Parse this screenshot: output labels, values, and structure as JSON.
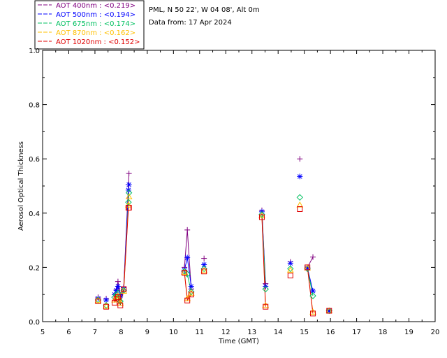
{
  "chart_data": {
    "type": "scatter",
    "title_lines": [
      "PML, N 50 22', W 04 08', Alt 0m",
      "Data from: 17 Apr 2024"
    ],
    "xlabel": "Time (GMT)",
    "ylabel": "Aerosol Optical Thickness",
    "xlim": [
      5,
      20
    ],
    "ylim": [
      0,
      1.0
    ],
    "xticks": [
      5,
      6,
      7,
      8,
      9,
      10,
      11,
      12,
      13,
      14,
      15,
      16,
      17,
      18,
      19,
      20
    ],
    "xtick_labels": [
      "5",
      "6",
      "7",
      "8",
      "9",
      "10",
      "11",
      "12",
      "13",
      "14",
      "15",
      "16",
      "17",
      "18",
      "19",
      "20"
    ],
    "yticks": [
      0,
      0.2,
      0.4,
      0.6,
      0.8,
      1.0
    ],
    "ytick_labels": [
      "0.0",
      "0.2",
      "0.4",
      "0.6",
      "0.8",
      "1.0"
    ],
    "grid": false,
    "legend_placement": "top-left",
    "series": [
      {
        "name": "AOT 400nm",
        "legend_label": "AOT  400nm : <0.219>",
        "color": "#800080",
        "marker": "plus",
        "x": [
          7.12,
          7.43,
          7.75,
          7.82,
          7.88,
          7.97,
          8.1,
          8.28,
          8.3,
          10.42,
          10.53,
          10.68,
          11.17,
          13.38,
          13.52,
          14.47,
          14.83,
          15.12,
          15.33,
          15.95
        ],
        "y": [
          0.09,
          0.085,
          0.1,
          0.12,
          0.148,
          0.1,
          0.125,
          0.505,
          0.546,
          0.2,
          0.338,
          0.12,
          0.233,
          0.41,
          0.14,
          0.22,
          0.6,
          0.2,
          0.238,
          0.04
        ],
        "segments": [
          [
            2,
            8
          ],
          [
            9,
            11
          ],
          [
            13,
            14
          ],
          [
            17,
            18
          ]
        ]
      },
      {
        "name": "AOT 500nm",
        "legend_label": "AOT  500nm : <0.194>",
        "color": "#0000ff",
        "marker": "asterisk",
        "x": [
          7.12,
          7.43,
          7.75,
          7.82,
          7.88,
          7.97,
          8.1,
          8.28,
          8.3,
          10.42,
          10.53,
          10.68,
          11.17,
          13.38,
          13.52,
          14.47,
          14.83,
          15.12,
          15.33,
          15.95
        ],
        "y": [
          0.085,
          0.08,
          0.1,
          0.115,
          0.13,
          0.095,
          0.12,
          0.485,
          0.505,
          0.19,
          0.236,
          0.13,
          0.21,
          0.405,
          0.13,
          0.215,
          0.535,
          0.198,
          0.113,
          0.04
        ],
        "segments": [
          [
            2,
            8
          ],
          [
            9,
            11
          ],
          [
            13,
            14
          ],
          [
            17,
            18
          ]
        ]
      },
      {
        "name": "AOT 675nm",
        "legend_label": "AOT  675nm : <0.174>",
        "color": "#00c060",
        "marker": "diamond",
        "x": [
          7.12,
          7.43,
          7.75,
          7.82,
          7.88,
          7.97,
          8.1,
          8.28,
          8.3,
          10.42,
          10.53,
          10.68,
          11.17,
          13.38,
          13.52,
          14.47,
          14.83,
          15.12,
          15.33,
          15.95
        ],
        "y": [
          0.08,
          0.06,
          0.09,
          0.1,
          0.105,
          0.075,
          0.115,
          0.44,
          0.475,
          0.185,
          0.175,
          0.11,
          0.195,
          0.395,
          0.12,
          0.195,
          0.458,
          0.195,
          0.095,
          0.04
        ],
        "segments": [
          [
            2,
            8
          ],
          [
            9,
            11
          ],
          [
            13,
            14
          ],
          [
            17,
            18
          ]
        ]
      },
      {
        "name": "AOT 870nm",
        "legend_label": "AOT  870nm : <0.162>",
        "color": "#ffc000",
        "marker": "triangle",
        "x": [
          7.12,
          7.43,
          7.75,
          7.82,
          7.88,
          7.97,
          8.1,
          8.28,
          8.3,
          10.42,
          10.53,
          10.68,
          11.17,
          13.38,
          13.52,
          14.47,
          14.83,
          15.12,
          15.33,
          15.95
        ],
        "y": [
          0.078,
          0.057,
          0.08,
          0.09,
          0.095,
          0.068,
          0.112,
          0.43,
          0.46,
          0.182,
          0.085,
          0.105,
          0.188,
          0.39,
          0.06,
          0.19,
          0.43,
          0.198,
          0.035,
          0.04
        ],
        "segments": [
          [
            2,
            8
          ],
          [
            9,
            11
          ],
          [
            13,
            14
          ],
          [
            17,
            18
          ]
        ]
      },
      {
        "name": "AOT 1020nm",
        "legend_label": "AOT 1020nm : <0.152>",
        "color": "#e00000",
        "marker": "square",
        "x": [
          7.12,
          7.43,
          7.75,
          7.82,
          7.88,
          7.97,
          8.1,
          8.28,
          8.3,
          10.42,
          10.53,
          10.68,
          11.17,
          13.38,
          13.52,
          14.47,
          14.83,
          15.12,
          15.33,
          15.95
        ],
        "y": [
          0.075,
          0.055,
          0.07,
          0.085,
          0.09,
          0.06,
          0.12,
          0.42,
          0.42,
          0.18,
          0.078,
          0.1,
          0.185,
          0.385,
          0.055,
          0.17,
          0.415,
          0.2,
          0.03,
          0.04
        ],
        "segments": [
          [
            2,
            8
          ],
          [
            9,
            11
          ],
          [
            13,
            14
          ],
          [
            17,
            18
          ]
        ]
      }
    ]
  }
}
